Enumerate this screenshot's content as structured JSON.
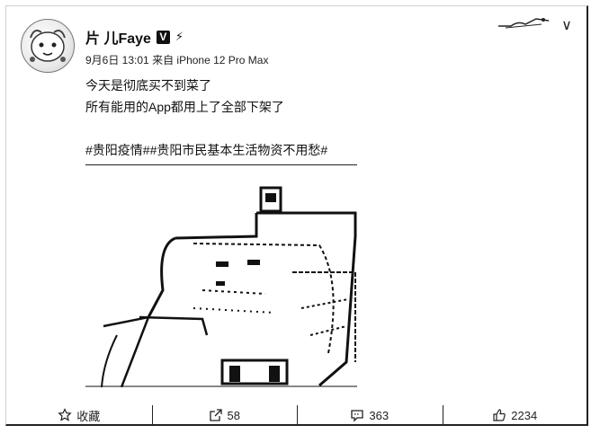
{
  "post": {
    "username": "片 儿Faye",
    "verified_badge": "V",
    "level_icon": "⚡",
    "timestamp": "9月6日 13:01",
    "source": "来自 iPhone 12 Pro Max",
    "text_lines": [
      "今天是彻底买不到菜了",
      "所有能用的App都用上了全部下架了"
    ],
    "hashtags": [
      "#贵阳疫情#",
      "#贵阳市民基本生活物资不用愁#"
    ]
  },
  "header": {
    "menu_icon": "chevron-down-icon",
    "chevron_glyph": "∨"
  },
  "actions": {
    "favorite_label": "收藏",
    "repost_count": "58",
    "comment_count": "363",
    "like_count": "2234"
  },
  "icons": {
    "favorite": "star-icon",
    "repost": "share-icon",
    "comment": "comment-icon",
    "like": "thumbs-up-icon"
  }
}
